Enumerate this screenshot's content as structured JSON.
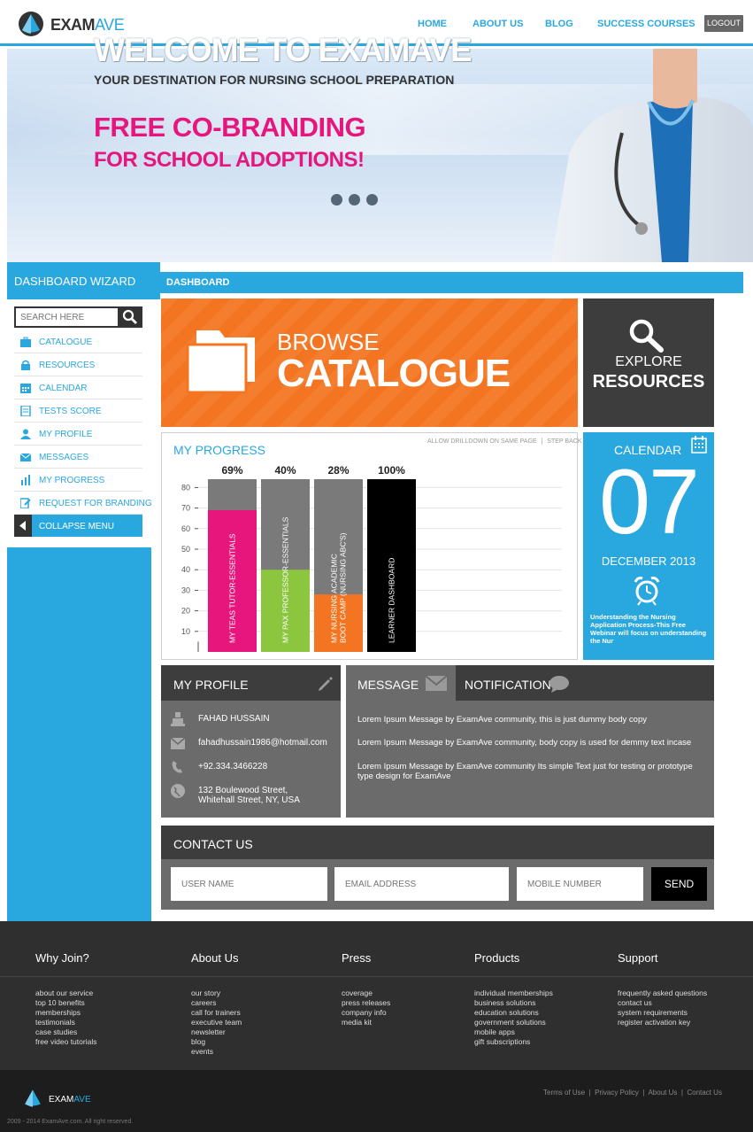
{
  "brand": {
    "name_main": "EXAM",
    "name_accent": "AVE",
    "accent_color": "#29a8e0"
  },
  "nav": {
    "items": [
      {
        "label": "HOME"
      },
      {
        "label": "ABOUT US"
      },
      {
        "label": "BLOG"
      },
      {
        "label": "SUCCESS COURSES"
      }
    ],
    "logout_label": "LOGOUT"
  },
  "hero": {
    "title": "WELCOME TO EXAMAVE",
    "subtitle": "YOUR DESTINATION FOR NURSING SCHOOL PREPARATION",
    "promo_line1": "FREE CO-BRANDING",
    "promo_line2": "FOR SCHOOL ADOPTIONS!",
    "promo_color": "#e6167d",
    "slide_count": 3
  },
  "sidebar": {
    "title": "DASHBOARD WIZARD",
    "search_placeholder": "SEARCH HERE",
    "items": [
      {
        "label": "CATALOGUE",
        "icon": "briefcase-icon"
      },
      {
        "label": "RESOURCES",
        "icon": "lock-icon"
      },
      {
        "label": "CALENDAR",
        "icon": "calendar-icon"
      },
      {
        "label": "TESTS SCORE",
        "icon": "document-icon"
      },
      {
        "label": "MY PROFILE",
        "icon": "user-icon"
      },
      {
        "label": "MESSAGES",
        "icon": "envelope-icon"
      },
      {
        "label": "MY PROGRESS",
        "icon": "bar-chart-icon"
      },
      {
        "label": "REQUEST FOR BRANDING",
        "icon": "edit-icon"
      }
    ],
    "collapse_label": "COLLAPSE MENU"
  },
  "dashboard": {
    "title": "DASHBOARD",
    "browse": {
      "line1": "BROWSE",
      "line2": "CATALOGUE",
      "color": "#f47521"
    },
    "explore": {
      "line1": "EXPLORE",
      "line2": "RESOURCES"
    }
  },
  "progress": {
    "title": "MY PROGRESS",
    "link1": "ALLOW DRILLDOWN ON SAME PAGE",
    "separator": "|",
    "link2": "STEP BACK"
  },
  "chart_data": {
    "type": "bar",
    "ylim": [
      0,
      85
    ],
    "yticks": [
      10,
      20,
      30,
      40,
      50,
      60,
      70,
      80
    ],
    "series": [
      {
        "label": "MY TEAS TUTOR-ESSENTIALS",
        "value": 69,
        "value_label": "69%",
        "color": "#e6167d"
      },
      {
        "label": "MY PAX PROFESSOR-ESSENTIALS",
        "value": 40,
        "value_label": "40%",
        "color": "#8cc63f"
      },
      {
        "label": "MY NURSING ACADEMIC BOOT CAMP (NURSING ABC'S)",
        "label_lines": [
          "MY NURSING ACADEMIC",
          "BOOT CAMP (NURSING ABC'S)"
        ],
        "value": 28,
        "value_label": "28%",
        "color": "#f47521"
      },
      {
        "label": "LEARNER DASHBOARD",
        "value": 100,
        "value_label": "100%",
        "color": "#000000"
      }
    ],
    "track_color": "#7a7a7a"
  },
  "calendar": {
    "title": "CALENDAR",
    "day": "07",
    "month_year": "DECEMBER 2013",
    "event_text": "Understanding the Nursing Application Process-This Free Webinar will focus on understanding the Nur"
  },
  "profile": {
    "title": "MY PROFILE",
    "name": "FAHAD HUSSAIN",
    "email": "fahadhussain1986@hotmail.com",
    "phone": "+92.334.3466228",
    "address_line1": "132 Boulewood Street,",
    "address_line2": "Whitehall Street, NY, USA"
  },
  "messages": {
    "tab_message": "MESSAGE",
    "tab_notification": "NOTIFICATION",
    "items": [
      "Lorem Ipsum Message by ExamAve community, this is just dummy body copy",
      "Lorem Ipsum Message by ExamAve community, body copy is used for demmy text incase",
      "Lorem Ipsum Message by ExamAve community Its simple Text just for testing or prototype type design for ExamAve"
    ]
  },
  "contact": {
    "title": "CONTACT US",
    "username_placeholder": "USER NAME",
    "email_placeholder": "EMAIL ADDRESS",
    "mobile_placeholder": "MOBILE NUMBER",
    "send_label": "SEND"
  },
  "footer": {
    "columns": [
      {
        "title": "Why Join?",
        "links": [
          "about our service",
          "top 10 benefits",
          "memberships",
          "testimonials",
          "case studies",
          "free video tutorials"
        ]
      },
      {
        "title": "About Us",
        "links": [
          "our story",
          "careers",
          "call for trainers",
          "executive team",
          "newsletter",
          "blog",
          "events"
        ]
      },
      {
        "title": "Press",
        "links": [
          "coverage",
          "press releases",
          "company info",
          "media kit"
        ]
      },
      {
        "title": "Products",
        "links": [
          "individual memberships",
          "business solutions",
          "education solutions",
          "government solutions",
          "mobile apps",
          "gift subscriptions"
        ]
      },
      {
        "title": "Support",
        "links": [
          "frequently asked questions",
          "contact us",
          "system requirements",
          "register activation key"
        ]
      }
    ],
    "logo_main": "EXAM",
    "logo_accent": "AVE",
    "copyright": "2009 - 2014 ExamAve.com. All right reserved.",
    "bottom_links": [
      "Terms of Use",
      "Privacy Policy",
      "About Us",
      "Contact Us"
    ]
  }
}
